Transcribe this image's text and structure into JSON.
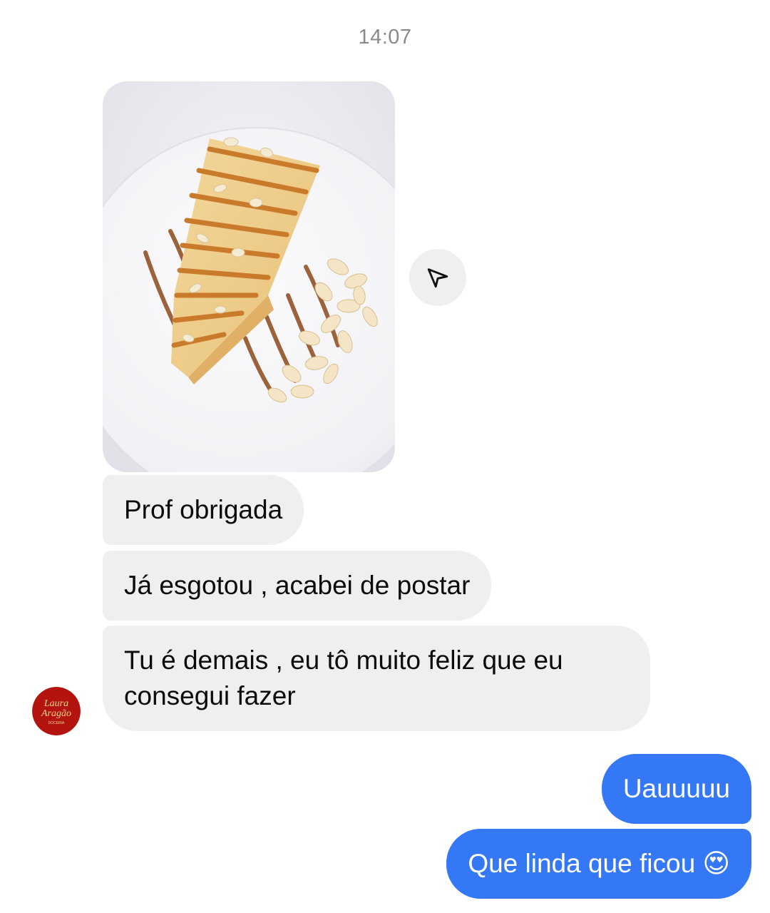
{
  "timestamp": "14:07",
  "messages": {
    "incoming": [
      {
        "text": "Prof obrigada"
      },
      {
        "text": "Já esgotou , acabei de postar"
      },
      {
        "line1": "Tu é demais , eu tô muito feliz que eu",
        "line2": "consegui fazer"
      }
    ],
    "outgoing": [
      {
        "text": "Uauuuuu"
      },
      {
        "text": "Que linda que ficou 😍"
      }
    ]
  },
  "avatar": {
    "logo_line1": "Laura",
    "logo_line2": "Aragão",
    "logo_line3": "DOCERIA",
    "color": "#b3140f"
  },
  "colors": {
    "incoming_bubble": "#efefef",
    "outgoing_bubble": "#3478f6",
    "timestamp": "#8a8a8e"
  },
  "icons": {
    "share": "paper-plane-icon"
  }
}
